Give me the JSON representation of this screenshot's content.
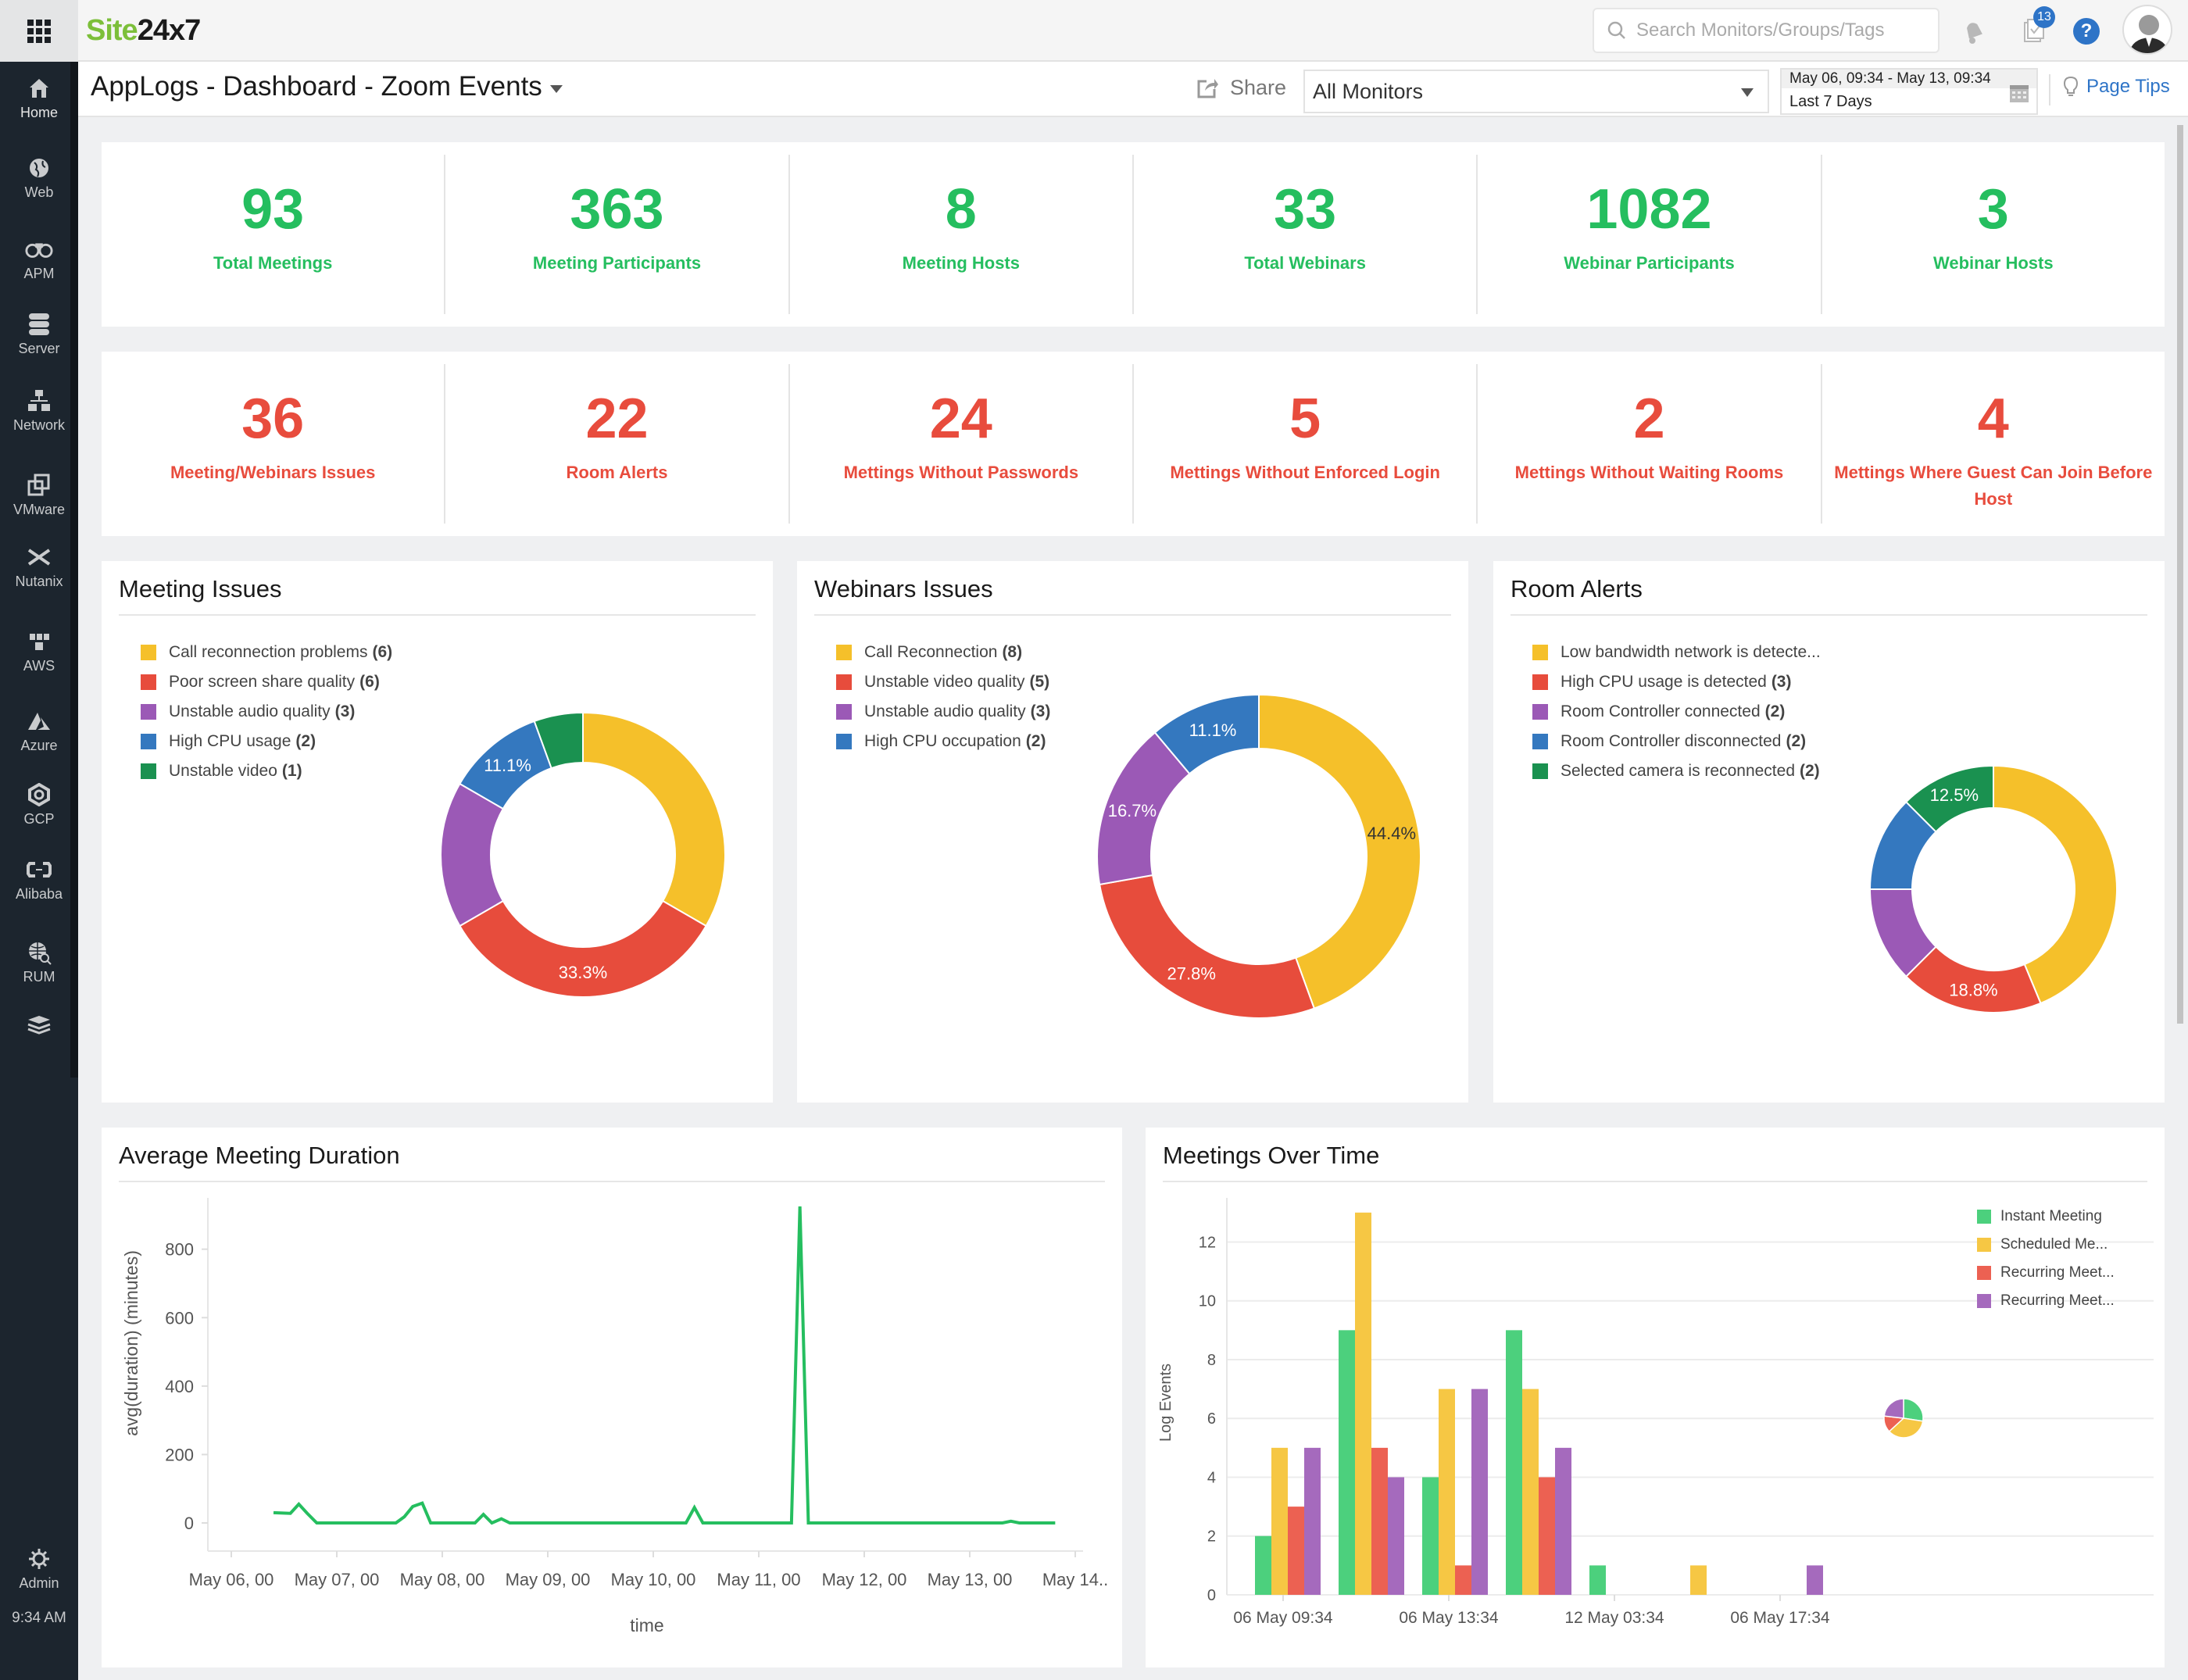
{
  "topbar": {
    "logo_part1": "Site",
    "logo_part2": "24x7",
    "search_placeholder": "Search Monitors/Groups/Tags",
    "notification_badge": "13",
    "help_label": "?"
  },
  "sidebar": {
    "items": [
      {
        "label": "Home",
        "icon": "home-icon"
      },
      {
        "label": "Web",
        "icon": "globe-icon"
      },
      {
        "label": "APM",
        "icon": "binoculars-icon"
      },
      {
        "label": "Server",
        "icon": "server-icon"
      },
      {
        "label": "Network",
        "icon": "network-icon"
      },
      {
        "label": "VMware",
        "icon": "vmware-icon"
      },
      {
        "label": "Nutanix",
        "icon": "nutanix-icon"
      },
      {
        "label": "AWS",
        "icon": "aws-icon"
      },
      {
        "label": "Azure",
        "icon": "azure-icon"
      },
      {
        "label": "GCP",
        "icon": "gcp-icon"
      },
      {
        "label": "Alibaba",
        "icon": "alibaba-icon"
      },
      {
        "label": "RUM",
        "icon": "rum-icon"
      },
      {
        "label": "",
        "icon": "layers-icon"
      }
    ],
    "admin_label": "Admin",
    "time": "9:34 AM"
  },
  "header": {
    "title": "AppLogs - Dashboard - Zoom Events",
    "share_label": "Share",
    "monitor_select": "All Monitors",
    "date_range": "May 06, 09:34 - May 13, 09:34",
    "date_preset": "Last 7 Days",
    "page_tips": "Page Tips"
  },
  "colors": {
    "green": "#25be5f",
    "red": "#e84c3d",
    "yellow": "#f5c02a",
    "red_slice": "#e74c3c",
    "purple": "#9b59b6",
    "blue": "#3478bf",
    "dark_green": "#1a9150",
    "bar_green": "#4cd07d",
    "bar_yellow": "#f6c744",
    "bar_red": "#ec6152",
    "bar_purple": "#a56abd",
    "accent_blue": "#2e74c7"
  },
  "kpis_row1": [
    {
      "value": "93",
      "label": "Total Meetings"
    },
    {
      "value": "363",
      "label": "Meeting Participants"
    },
    {
      "value": "8",
      "label": "Meeting Hosts"
    },
    {
      "value": "33",
      "label": "Total Webinars"
    },
    {
      "value": "1082",
      "label": "Webinar Participants"
    },
    {
      "value": "3",
      "label": "Webinar Hosts"
    }
  ],
  "kpis_row2": [
    {
      "value": "36",
      "label": "Meeting/Webinars Issues"
    },
    {
      "value": "22",
      "label": "Room Alerts"
    },
    {
      "value": "24",
      "label": "Mettings Without Passwords"
    },
    {
      "value": "5",
      "label": "Mettings Without Enforced Login"
    },
    {
      "value": "2",
      "label": "Mettings Without Waiting Rooms"
    },
    {
      "value": "4",
      "label": "Mettings Where Guest Can Join Before Host"
    }
  ],
  "chart_data": [
    {
      "type": "pie",
      "variant": "donut",
      "title": "Meeting Issues",
      "legend_position": "top-left",
      "slices": [
        {
          "label": "Call reconnection problems",
          "value": 6,
          "count_label": "(6)",
          "color": "#f5c02a",
          "pct_label": ""
        },
        {
          "label": "Poor screen share quality",
          "value": 6,
          "count_label": "(6)",
          "color": "#e74c3c",
          "pct_label": "33.3%"
        },
        {
          "label": "Unstable audio quality",
          "value": 3,
          "count_label": "(3)",
          "color": "#9b59b6",
          "pct_label": ""
        },
        {
          "label": "High CPU usage",
          "value": 2,
          "count_label": "(2)",
          "color": "#3478bf",
          "pct_label": "11.1%"
        },
        {
          "label": "Unstable video",
          "value": 1,
          "count_label": "(1)",
          "color": "#1a9150",
          "pct_label": ""
        }
      ]
    },
    {
      "type": "pie",
      "variant": "donut",
      "title": "Webinars Issues",
      "legend_position": "top-left",
      "slices": [
        {
          "label": "Call Reconnection",
          "value": 8,
          "count_label": "(8)",
          "color": "#f5c02a",
          "pct_label": "44.4%"
        },
        {
          "label": "Unstable video quality",
          "value": 5,
          "count_label": "(5)",
          "color": "#e74c3c",
          "pct_label": "27.8%"
        },
        {
          "label": "Unstable audio quality",
          "value": 3,
          "count_label": "(3)",
          "color": "#9b59b6",
          "pct_label": "16.7%"
        },
        {
          "label": "High CPU occupation",
          "value": 2,
          "count_label": "(2)",
          "color": "#3478bf",
          "pct_label": "11.1%"
        }
      ]
    },
    {
      "type": "pie",
      "variant": "donut",
      "title": "Room Alerts",
      "legend_position": "top-left",
      "slices": [
        {
          "label": "Low bandwidth network is detecte...",
          "value": 7,
          "count_label": "",
          "color": "#f5c02a",
          "pct_label": ""
        },
        {
          "label": "High CPU usage is detected",
          "value": 3,
          "count_label": "(3)",
          "color": "#e74c3c",
          "pct_label": "18.8%"
        },
        {
          "label": "Room Controller connected",
          "value": 2,
          "count_label": "(2)",
          "color": "#9b59b6",
          "pct_label": ""
        },
        {
          "label": "Room Controller disconnected",
          "value": 2,
          "count_label": "(2)",
          "color": "#3478bf",
          "pct_label": ""
        },
        {
          "label": "Selected camera is reconnected",
          "value": 2,
          "count_label": "(2)",
          "color": "#1a9150",
          "pct_label": "12.5%"
        }
      ]
    },
    {
      "type": "line",
      "title": "Average Meeting Duration",
      "xlabel": "time",
      "ylabel": "avg(duration) (minutes)",
      "ylim": [
        0,
        950
      ],
      "yticks": [
        0,
        200,
        400,
        600,
        800
      ],
      "xlim_days": [
        0,
        8
      ],
      "xtick_labels": [
        "May 06, 00",
        "May 07, 00",
        "May 08, 00",
        "May 09, 00",
        "May 10, 00",
        "May 11, 00",
        "May 12, 00",
        "May 13, 00",
        "May 14.."
      ],
      "grid": false,
      "color": "#25be5f",
      "series": [
        {
          "name": "avg(duration)",
          "x_days": [
            0.4,
            0.56,
            0.64,
            0.72,
            0.81,
            1.56,
            1.64,
            1.72,
            1.81,
            1.89,
            2.31,
            2.39,
            2.47,
            2.56,
            2.64,
            4.31,
            4.39,
            4.47,
            5.31,
            5.39,
            5.47,
            7.31,
            7.39,
            7.47,
            7.81
          ],
          "values": [
            30,
            28,
            55,
            28,
            0,
            0,
            18,
            48,
            58,
            0,
            0,
            25,
            0,
            12,
            0,
            0,
            45,
            0,
            0,
            925,
            0,
            0,
            5,
            0,
            0
          ]
        }
      ]
    },
    {
      "type": "bar",
      "title": "Meetings Over Time",
      "xlabel": "",
      "ylabel": "Log Events",
      "ylim": [
        0,
        13.5
      ],
      "yticks": [
        0,
        2,
        4,
        6,
        8,
        10,
        12
      ],
      "grid": true,
      "legend_position": "top-right",
      "xtick_labels": [
        "06 May 09:34",
        "06 May 13:34",
        "12 May 03:34",
        "06 May 17:34"
      ],
      "categories": [
        "g1",
        "g2",
        "g3",
        "g4",
        "g5",
        "g6",
        "g7"
      ],
      "series": [
        {
          "name": "Instant Meeting",
          "color": "#4cd07d",
          "values": [
            2,
            9,
            4,
            9,
            1,
            0,
            0
          ]
        },
        {
          "name": "Scheduled Me...",
          "color": "#f6c744",
          "values": [
            5,
            13,
            7,
            7,
            0,
            1,
            0
          ]
        },
        {
          "name": "Recurring Meet...",
          "color": "#ec6152",
          "values": [
            3,
            5,
            1,
            4,
            0,
            0,
            0
          ]
        },
        {
          "name": "Recurring Meet...",
          "color": "#a56abd",
          "values": [
            5,
            4,
            7,
            5,
            0,
            0,
            1
          ]
        }
      ],
      "mini_pie": [
        {
          "color": "#4cd07d",
          "value": 26
        },
        {
          "color": "#f6c744",
          "value": 34
        },
        {
          "color": "#ec6152",
          "value": 13
        },
        {
          "color": "#a56abd",
          "value": 22
        }
      ]
    }
  ]
}
